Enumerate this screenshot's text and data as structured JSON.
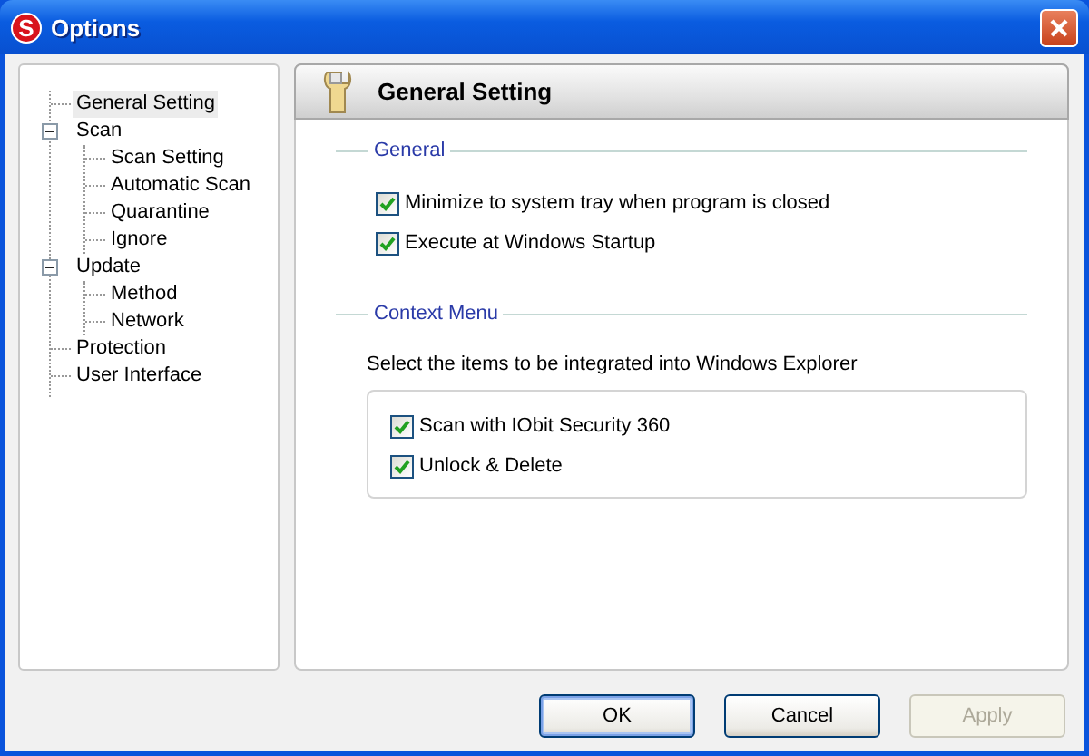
{
  "window": {
    "title": "Options",
    "logo_letter": "S"
  },
  "tree": [
    {
      "label": "General Setting",
      "selected": true
    },
    {
      "label": "Scan",
      "selected": false,
      "expanded": true,
      "children": [
        {
          "label": "Scan Setting",
          "selected": false
        },
        {
          "label": "Automatic Scan",
          "selected": false
        },
        {
          "label": "Quarantine",
          "selected": false
        },
        {
          "label": "Ignore",
          "selected": false
        }
      ]
    },
    {
      "label": "Update",
      "selected": false,
      "expanded": true,
      "children": [
        {
          "label": "Method",
          "selected": false
        },
        {
          "label": "Network",
          "selected": false
        }
      ]
    },
    {
      "label": "Protection",
      "selected": false
    },
    {
      "label": "User Interface",
      "selected": false
    }
  ],
  "panel": {
    "title": "General Setting"
  },
  "sections": [
    {
      "kind": "plain",
      "title": "General",
      "options": [
        {
          "label": "Minimize to system tray when program is closed",
          "checked": true
        },
        {
          "label": "Execute at Windows Startup",
          "checked": true
        }
      ]
    },
    {
      "kind": "group",
      "title": "Context Menu",
      "description": "Select the items to be integrated into Windows Explorer",
      "options": [
        {
          "label": "Scan with IObit Security 360",
          "checked": true
        },
        {
          "label": "Unlock & Delete",
          "checked": true
        }
      ]
    }
  ],
  "buttons": [
    {
      "label": "OK",
      "default": true,
      "disabled": false
    },
    {
      "label": "Cancel",
      "default": false,
      "disabled": false
    },
    {
      "label": "Apply",
      "default": false,
      "disabled": true
    }
  ]
}
